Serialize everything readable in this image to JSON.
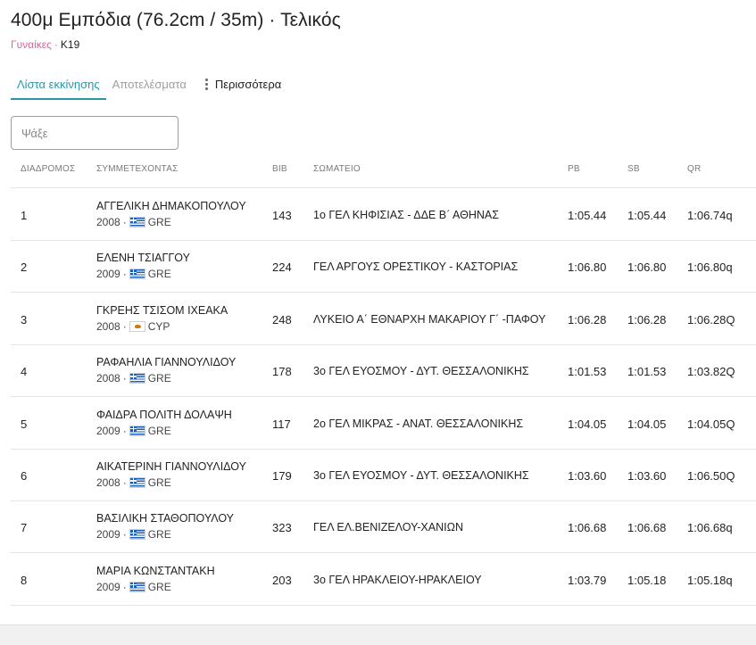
{
  "header": {
    "title": "400μ Εμπόδια (76.2cm / 35m) · Τελικός",
    "gender": "Γυναίκες",
    "category": "K19"
  },
  "tabs": [
    {
      "label": "Λίστα εκκίνησης",
      "active": true
    },
    {
      "label": "Αποτελέσματα",
      "active": false
    },
    {
      "label": "Περισσότερα",
      "active": false
    }
  ],
  "search": {
    "placeholder": "Ψάξε",
    "value": ""
  },
  "columns": {
    "lane": "ΔΙΑΔΡΟΜΟΣ",
    "athlete": "ΣΥΜΜΕΤΕΧΟΝΤΑΣ",
    "bib": "BIB",
    "club": "ΣΩΜΑΤΕΙΟ",
    "pb": "PB",
    "sb": "SB",
    "qr": "QR"
  },
  "rows": [
    {
      "lane": "1",
      "name": "ΑΓΓΕΛΙΚΗ ΔΗΜΑΚΟΠΟΥΛΟΥ",
      "year": "2008",
      "flag": "greece-flag-icon",
      "country": "GRE",
      "bib": "143",
      "club": "1ο ΓΕΛ ΚΗΦΙΣΙΑΣ - ΔΔΕ Β΄ ΑΘΗΝΑΣ",
      "pb": "1:05.44",
      "sb": "1:05.44",
      "qr": "1:06.74q"
    },
    {
      "lane": "2",
      "name": "ΕΛΕΝΗ ΤΣΙΑΓΓΟΥ",
      "year": "2009",
      "flag": "greece-flag-icon",
      "country": "GRE",
      "bib": "224",
      "club": "ΓΕΛ ΑΡΓΟΥΣ ΟΡΕΣΤΙΚΟΥ - ΚΑΣΤΟΡΙΑΣ",
      "pb": "1:06.80",
      "sb": "1:06.80",
      "qr": "1:06.80q"
    },
    {
      "lane": "3",
      "name": "ΓΚΡΕΗΣ ΤΣΙΣΟΜ ΙΧΕΑΚΑ",
      "year": "2008",
      "flag": "cyprus-flag-icon",
      "country": "CYP",
      "bib": "248",
      "club": "ΛΥΚΕΙΟ Α΄ ΕΘΝΑΡΧΗ ΜΑΚΑΡΙΟΥ Γ΄ -ΠΑΦΟΥ",
      "pb": "1:06.28",
      "sb": "1:06.28",
      "qr": "1:06.28Q"
    },
    {
      "lane": "4",
      "name": "ΡΑΦΑΗΛΙΑ ΓΙΑΝΝΟΥΛΙΔΟΥ",
      "year": "2008",
      "flag": "greece-flag-icon",
      "country": "GRE",
      "bib": "178",
      "club": "3ο ΓΕΛ ΕΥΟΣΜΟΥ - ΔΥΤ. ΘΕΣΣΑΛΟΝΙΚΗΣ",
      "pb": "1:01.53",
      "sb": "1:01.53",
      "qr": "1:03.82Q"
    },
    {
      "lane": "5",
      "name": "ΦΑΙΔΡΑ ΠΟΛΙΤΗ ΔΟΛΑΨΗ",
      "year": "2009",
      "flag": "greece-flag-icon",
      "country": "GRE",
      "bib": "117",
      "club": "2ο ΓΕΛ ΜΙΚΡΑΣ - ΑΝΑΤ. ΘΕΣΣΑΛΟΝΙΚΗΣ",
      "pb": "1:04.05",
      "sb": "1:04.05",
      "qr": "1:04.05Q"
    },
    {
      "lane": "6",
      "name": "ΑΙΚΑΤΕΡΙΝΗ ΓΙΑΝΝΟΥΛΙΔΟΥ",
      "year": "2008",
      "flag": "greece-flag-icon",
      "country": "GRE",
      "bib": "179",
      "club": "3ο ΓΕΛ ΕΥΟΣΜΟΥ - ΔΥΤ. ΘΕΣΣΑΛΟΝΙΚΗΣ",
      "pb": "1:03.60",
      "sb": "1:03.60",
      "qr": "1:06.50Q"
    },
    {
      "lane": "7",
      "name": "ΒΑΣΙΛΙΚΗ ΣΤΑΘΟΠΟΥΛΟΥ",
      "year": "2009",
      "flag": "greece-flag-icon",
      "country": "GRE",
      "bib": "323",
      "club": "ΓΕΛ ΕΛ.ΒΕΝΙΖΕΛΟΥ-ΧΑΝΙΩΝ",
      "pb": "1:06.68",
      "sb": "1:06.68",
      "qr": "1:06.68q"
    },
    {
      "lane": "8",
      "name": "ΜΑΡΙΑ ΚΩΝΣΤΑΝΤΑΚΗ",
      "year": "2009",
      "flag": "greece-flag-icon",
      "country": "GRE",
      "bib": "203",
      "club": "3ο ΓΕΛ ΗΡΑΚΛΕΙΟΥ-ΗΡΑΚΛΕΙΟΥ",
      "pb": "1:03.79",
      "sb": "1:05.18",
      "qr": "1:05.18q"
    }
  ],
  "colors": {
    "accent": "#2a96a8",
    "gender": "#e0619a"
  }
}
